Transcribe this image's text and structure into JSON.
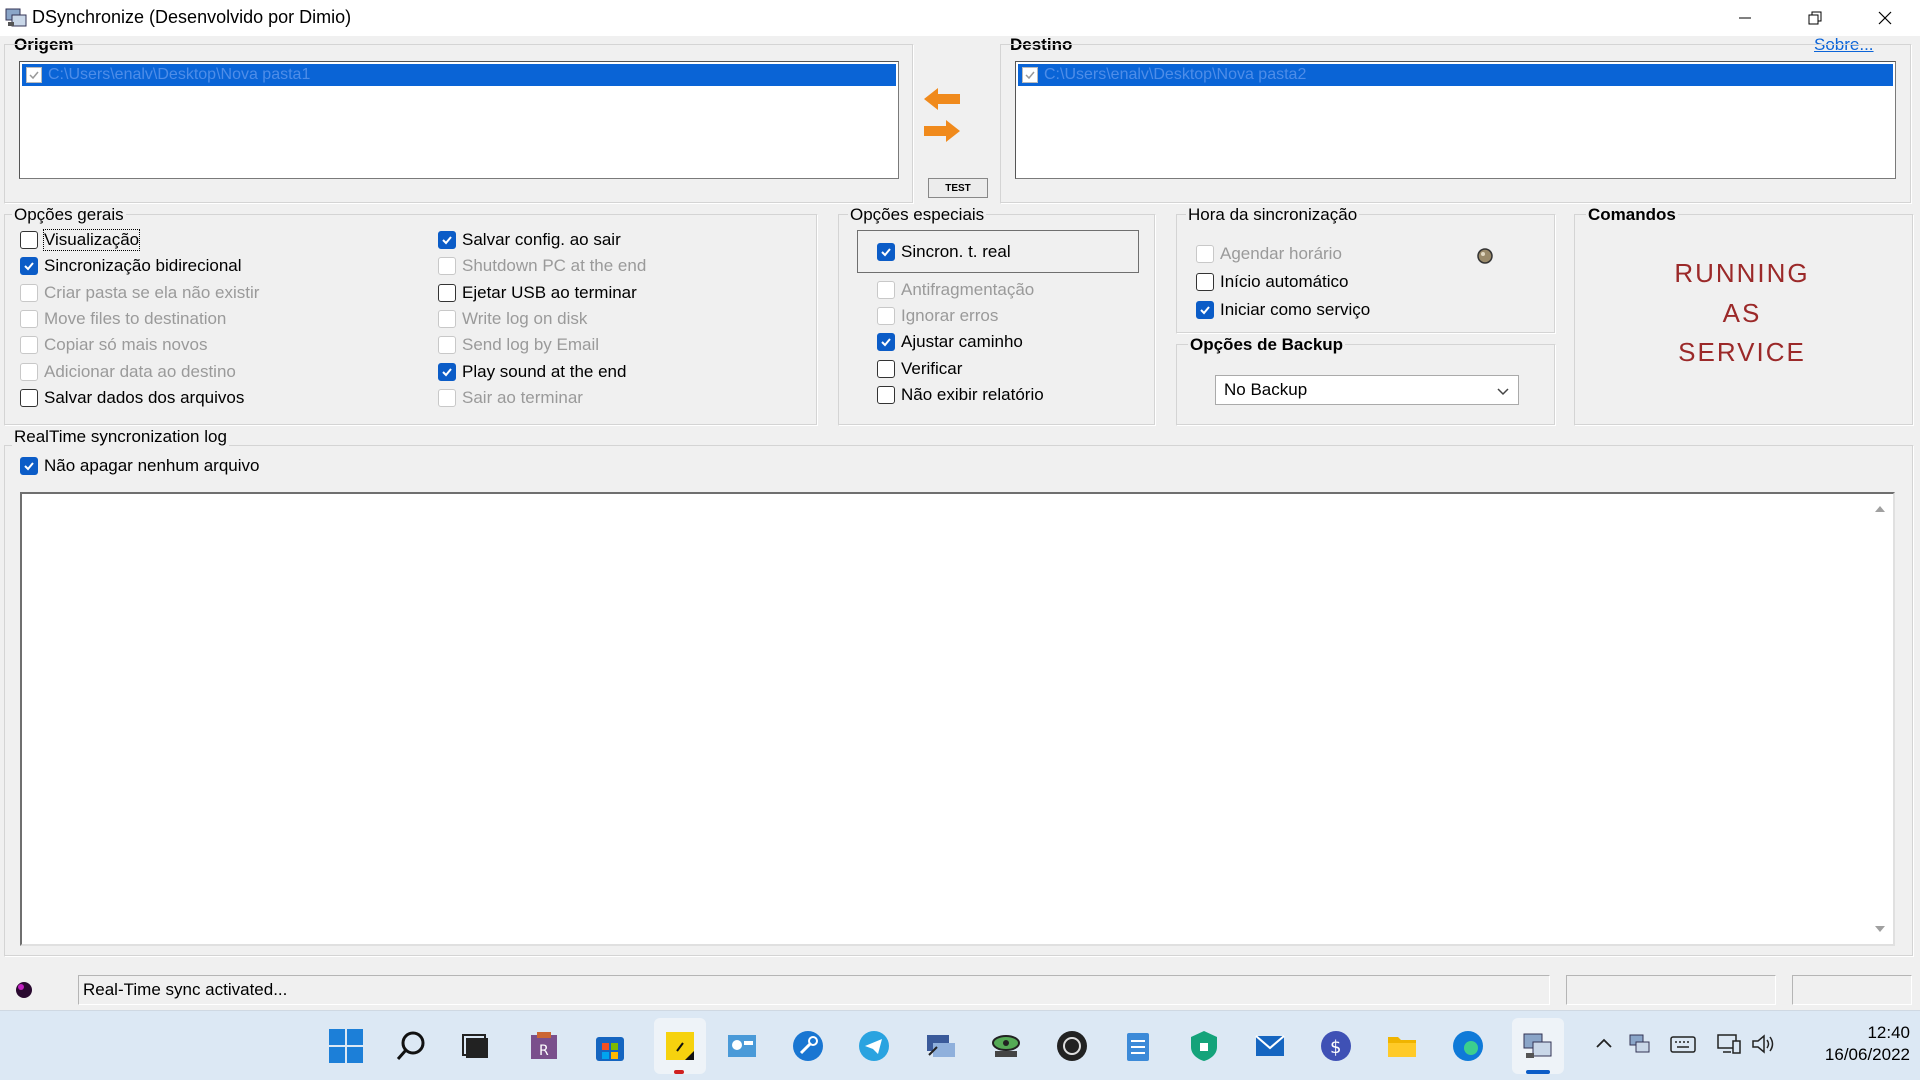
{
  "window": {
    "title": "DSynchronize (Desenvolvido por Dimio)"
  },
  "origem": {
    "label": "Origem",
    "path": "C:\\Users\\enalv\\Desktop\\Nova pasta1"
  },
  "destino": {
    "label": "Destino",
    "path": "C:\\Users\\enalv\\Desktop\\Nova pasta2",
    "sobre_link": "Sobre..."
  },
  "test_button": "TEST",
  "opcoes_gerais": {
    "label": "Opções gerais",
    "col1": [
      {
        "label": "Visualização",
        "checked": false,
        "enabled": true
      },
      {
        "label": "Sincronização bidirecional",
        "checked": true,
        "enabled": true
      },
      {
        "label": "Criar pasta se ela não existir",
        "checked": false,
        "enabled": false
      },
      {
        "label": "Move files to destination",
        "checked": false,
        "enabled": false
      },
      {
        "label": "Copiar só mais novos",
        "checked": false,
        "enabled": false
      },
      {
        "label": "Adicionar data ao destino",
        "checked": false,
        "enabled": false
      },
      {
        "label": "Salvar dados dos arquivos",
        "checked": false,
        "enabled": true
      }
    ],
    "col2": [
      {
        "label": "Salvar config. ao sair",
        "checked": true,
        "enabled": true
      },
      {
        "label": "Shutdown PC at the end",
        "checked": false,
        "enabled": false
      },
      {
        "label": "Ejetar USB ao terminar",
        "checked": false,
        "enabled": true
      },
      {
        "label": "Write log on disk",
        "checked": false,
        "enabled": false
      },
      {
        "label": "Send log by Email",
        "checked": false,
        "enabled": false
      },
      {
        "label": "Play sound at the end",
        "checked": true,
        "enabled": true
      },
      {
        "label": "Sair ao terminar",
        "checked": false,
        "enabled": false
      }
    ]
  },
  "opcoes_especiais": {
    "label": "Opções especiais",
    "items": [
      {
        "label": "Sincron. t. real",
        "checked": true,
        "enabled": true
      },
      {
        "label": "Antifragmentação",
        "checked": false,
        "enabled": false
      },
      {
        "label": "Ignorar erros",
        "checked": false,
        "enabled": false
      },
      {
        "label": "Ajustar caminho",
        "checked": true,
        "enabled": true
      },
      {
        "label": "Verificar",
        "checked": false,
        "enabled": true
      },
      {
        "label": "Não exibir relatório",
        "checked": false,
        "enabled": true
      }
    ]
  },
  "hora_sincronizacao": {
    "label": "Hora da sincronização",
    "items": [
      {
        "label": "Agendar horário",
        "checked": false,
        "enabled": false
      },
      {
        "label": "Início automático",
        "checked": false,
        "enabled": true
      },
      {
        "label": "Iniciar como serviço",
        "checked": true,
        "enabled": true
      }
    ]
  },
  "backup": {
    "label": "Opções de Backup",
    "selected": "No Backup"
  },
  "comandos": {
    "label": "Comandos",
    "line1": "RUNNING",
    "line2": "AS",
    "line3": "SERVICE"
  },
  "log": {
    "label": "RealTime syncronization log",
    "no_delete": {
      "label": "Não apagar nenhum arquivo",
      "checked": true
    }
  },
  "status": {
    "message": "Real-Time sync activated..."
  },
  "taskbar": {
    "time": "12:40",
    "date": "16/06/2022"
  },
  "colors": {
    "selection": "#0a64d6",
    "checkbox_accent": "#0b5cc7",
    "arrow": "#f08a1c",
    "running_text": "#9b2929"
  }
}
